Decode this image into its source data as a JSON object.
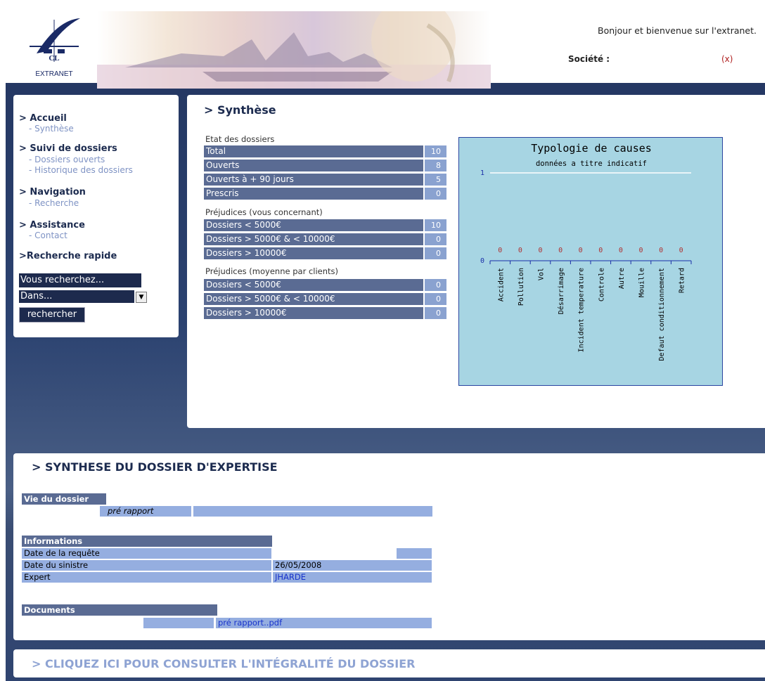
{
  "header": {
    "logo_letters": "CL",
    "logo_caption": "EXTRANET",
    "welcome": "Bonjour et bienvenue sur l'extranet.",
    "societe_label": "Société :",
    "logout": "(x)"
  },
  "menu": {
    "accueil": "> Accueil",
    "synthese": "- Synthèse",
    "suivi": "> Suivi de dossiers",
    "dossiers_ouverts": "- Dossiers ouverts",
    "historique": "- Historique des dossiers",
    "navigation": "> Navigation",
    "recherche": "- Recherche",
    "assistance": "> Assistance",
    "contact": "- Contact",
    "recherche_rapide": ">Recherche rapide",
    "search_placeholder": "Vous recherchez...",
    "select_value": "Dans...",
    "search_button": "rechercher"
  },
  "synthese": {
    "title": "> Synthèse",
    "etat_label": "Etat des dossiers",
    "etat_rows": [
      {
        "label": "Total",
        "value": "10"
      },
      {
        "label": "Ouverts",
        "value": "8"
      },
      {
        "label": "Ouverts à + 90 jours",
        "value": "5"
      },
      {
        "label": "Prescris",
        "value": "0"
      }
    ],
    "prej_label": "Préjudices (vous concernant)",
    "prej_rows": [
      {
        "label": "Dossiers < 5000€",
        "value": "10"
      },
      {
        "label": "Dossiers > 5000€ & < 10000€",
        "value": "0"
      },
      {
        "label": "Dossiers > 10000€",
        "value": "0"
      }
    ],
    "moy_label": "Préjudices (moyenne par clients)",
    "moy_rows": [
      {
        "label": "Dossiers < 5000€",
        "value": "0"
      },
      {
        "label": "Dossiers > 5000€ & < 10000€",
        "value": "0"
      },
      {
        "label": "Dossiers > 10000€",
        "value": "0"
      }
    ]
  },
  "chart_data": {
    "type": "bar",
    "title": "Typologie de causes",
    "subtitle": "données a titre indicatif",
    "categories": [
      "Accident",
      "Pollution",
      "Vol",
      "Désarrimage",
      "Incident temperature",
      "Controle",
      "Autre",
      "Mouille",
      "Defaut conditionnement",
      "Retard"
    ],
    "values": [
      0,
      0,
      0,
      0,
      0,
      0,
      0,
      0,
      0,
      0
    ],
    "ylim": [
      0,
      1
    ],
    "y_ticks": [
      "0",
      "1"
    ],
    "grid": false,
    "background": "#a7d5e3",
    "value_label_color": "#b03030"
  },
  "dossier": {
    "title": "> SYNTHESE DU DOSSIER D'EXPERTISE",
    "vie_header": "Vie du dossier",
    "vie_value": "pré rapport",
    "info_header": "Informations",
    "info_rows": [
      {
        "label": "Date de la requête",
        "value": ""
      },
      {
        "label": "Date du sinistre",
        "value": "26/05/2008"
      },
      {
        "label": "Expert",
        "value": "JHARDE"
      }
    ],
    "docs_header": "Documents",
    "doc_link": "pré rapport..pdf"
  },
  "footer": {
    "link": "> CLIQUEZ ICI POUR CONSULTER L'INTÉGRALITÉ DU DOSSIER"
  },
  "colors": {
    "dark_navy": "#1c2b4f",
    "row_label_bg": "#5a6b93",
    "row_value_bg": "#8aa2d0",
    "link_light": "#8ea3d3"
  }
}
